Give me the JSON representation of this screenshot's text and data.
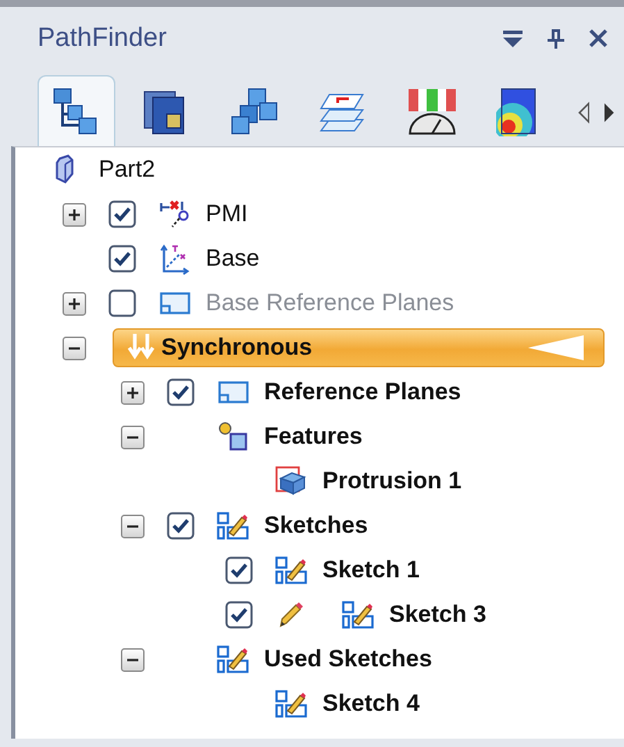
{
  "panel": {
    "title": "PathFinder"
  },
  "tabs": [
    {
      "kind": "tree",
      "selected": true
    },
    {
      "kind": "pages",
      "selected": false
    },
    {
      "kind": "assembly",
      "selected": false
    },
    {
      "kind": "layers",
      "selected": false
    },
    {
      "kind": "gauge",
      "selected": false
    },
    {
      "kind": "heatmap",
      "selected": false
    }
  ],
  "tree": {
    "label": "Part2",
    "kind": "part",
    "bold": false,
    "children": [
      {
        "label": "PMI",
        "kind": "pmi",
        "expanded": false,
        "checked": true,
        "bold": false
      },
      {
        "label": "Base",
        "kind": "coords",
        "checked": true,
        "bold": false
      },
      {
        "label": "Base Reference Planes",
        "kind": "plane",
        "expanded": false,
        "checked": false,
        "disabled": true,
        "bold": false
      },
      {
        "label": "Synchronous",
        "kind": "sync",
        "expanded": true,
        "selected": true,
        "bold": true,
        "children": [
          {
            "label": "Reference Planes",
            "kind": "plane",
            "expanded": false,
            "checked": true,
            "bold": true
          },
          {
            "label": "Features",
            "kind": "features",
            "expanded": true,
            "bold": true,
            "children": [
              {
                "label": "Protrusion 1",
                "kind": "protrusion",
                "bold": true
              }
            ]
          },
          {
            "label": "Sketches",
            "kind": "sketch",
            "expanded": true,
            "checked": true,
            "bold": true,
            "children": [
              {
                "label": "Sketch 1",
                "kind": "sketch",
                "checked": true,
                "bold": true
              },
              {
                "label": "Sketch 3",
                "kind": "sketch",
                "checked": true,
                "editing": true,
                "bold": true
              }
            ]
          },
          {
            "label": "Used Sketches",
            "kind": "sketch",
            "expanded": true,
            "bold": true,
            "children": [
              {
                "label": "Sketch 4",
                "kind": "sketch",
                "bold": true
              }
            ]
          }
        ]
      }
    ]
  }
}
